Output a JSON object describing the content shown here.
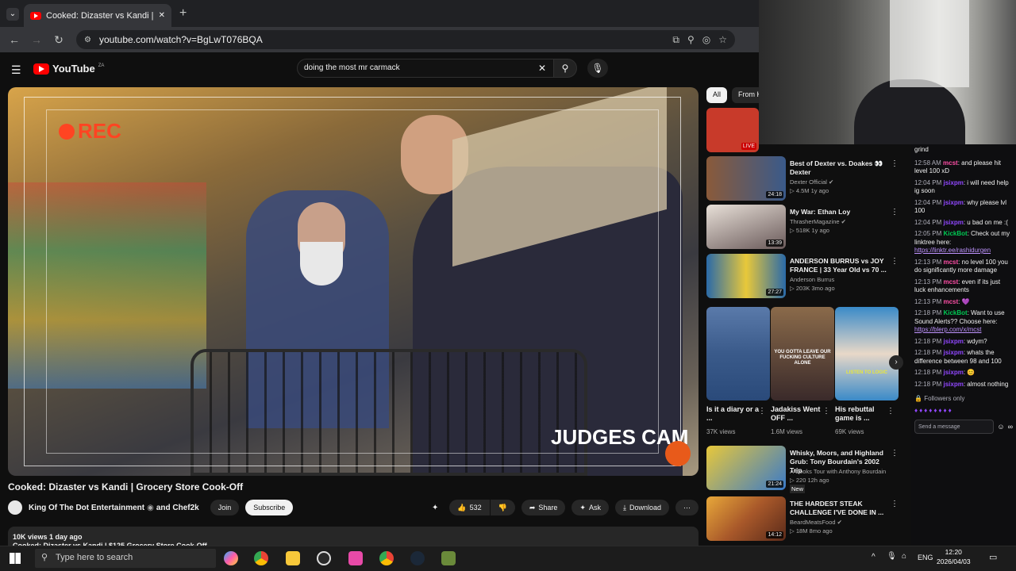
{
  "browser": {
    "tab_title": "Cooked: Dizaster vs Kandi |",
    "new_tab": "+",
    "url": "youtube.com/watch?v=BgLwT076BQA"
  },
  "youtube": {
    "logo_text": "YouTube",
    "logo_country": "ZA",
    "search_value": "doing the most mr carmack",
    "search_clear": "✕"
  },
  "video": {
    "overlay_rec": "REC",
    "overlay_label": "JUDGES CAM",
    "title": "Cooked: Dizaster vs Kandi | Grocery Store Cook-Off",
    "channel": "King Of The Dot Entertainment",
    "collab": "and Chef2k",
    "join_label": "Join",
    "subscribe_label": "Subscribe",
    "likes": "532",
    "share_label": "Share",
    "ask_label": "Ask",
    "download_label": "Download",
    "stats": "10K views  1 day ago",
    "desc_preview": "Cooked: Dizaster vs Kandi | $125 Grocery Store Cook-Off"
  },
  "sidebar": {
    "chips": [
      "All",
      "From Ki"
    ],
    "items": [
      {
        "title": "",
        "channel": "",
        "meta": "",
        "duration": "LIVE",
        "thumb": "#c83a2a"
      },
      {
        "title": "Best of Dexter vs. Doakes 👀 Dexter",
        "channel": "Dexter Official ✔",
        "meta": "▷ 4.5M  1y ago",
        "duration": "24:18",
        "thumb": "#3a5a8a"
      },
      {
        "title": "My War: Ethan Loy",
        "channel": "ThrasherMagazine ✔",
        "meta": "▷ 518K  1y ago",
        "duration": "13:39",
        "thumb": "#6a5a5a"
      },
      {
        "title": "ANDERSON BURRUS vs JOY FRANCE | 33 Year Old vs 70 ...",
        "channel": "Anderson Burrus",
        "meta": "▷ 203K  3mo ago",
        "duration": "27:27",
        "thumb": "#2a6aa8"
      },
      {
        "title": "Whisky, Moors, and Highland Grub: Tony Bourdain's 2002 Trip",
        "channel": "A Cooks Tour with Anthony Bourdain",
        "meta": "▷ 220  12h ago",
        "badge": "New",
        "duration": "21:24",
        "thumb": "#c8a83a"
      },
      {
        "title": "THE HARDEST STEAK CHALLENGE I'VE DONE IN ...",
        "channel": "BeardMeatsFood ✔",
        "meta": "▷ 18M  8mo ago",
        "duration": "14:12",
        "thumb": "#a8582a"
      }
    ],
    "shorts": [
      {
        "title": "Is it a diary or a ...",
        "views": "37K views",
        "thumb": "#4a6a9a"
      },
      {
        "title": "Jadakiss Went OFF ...",
        "views": "1.6M views",
        "thumb": "#5a4a3a",
        "caption": "YOU GOTTA LEAVE OUR FUCKING CULTURE ALONE"
      },
      {
        "title": "His rebuttal game is ...",
        "views": "69K views",
        "thumb": "#3a8ac8",
        "caption": "LISTEN TO LOGIC"
      }
    ]
  },
  "chat": {
    "messages": [
      {
        "ts": "",
        "user": "",
        "text": "grind"
      },
      {
        "ts": "12:58 AM",
        "user": "mcst",
        "text": ": and please hit level 100 xD"
      },
      {
        "ts": "12:04 PM",
        "user": "jsixpm",
        "text": ": i will need help ig soon"
      },
      {
        "ts": "12:04 PM",
        "user": "jsixpm",
        "text": ": why please lvl 100"
      },
      {
        "ts": "12:04 PM",
        "user": "jsixpm",
        "text": ": u bad on me :("
      },
      {
        "ts": "12:05 PM",
        "user": "KickBot",
        "text": ": Check out my linktree here:",
        "link": "https://linktr.ee/rashidurgen"
      },
      {
        "ts": "12:13 PM",
        "user": "mcst",
        "text": ": no level 100 you do significantly more damage"
      },
      {
        "ts": "12:13 PM",
        "user": "mcst",
        "text": ": even if its just luck enhancements"
      },
      {
        "ts": "12:13 PM",
        "user": "mcst",
        "text": ": 💜"
      },
      {
        "ts": "12:18 PM",
        "user": "KickBot",
        "text": ": Want to use Sound Alerts?? Choose here:",
        "link": "https://blerp.com/x/mcst"
      },
      {
        "ts": "12:18 PM",
        "user": "jsixpm",
        "text": ": wdym?"
      },
      {
        "ts": "12:18 PM",
        "user": "jsixpm",
        "text": ": whats the difference between 98 and 100"
      },
      {
        "ts": "12:18 PM",
        "user": "jsixpm",
        "text": ": 😊"
      },
      {
        "ts": "12:18 PM",
        "user": "jsixpm",
        "text": ": almost nothing"
      }
    ],
    "followers_only": "Followers only",
    "send_placeholder": "Send a message"
  },
  "taskbar": {
    "search_placeholder": "Type here to search",
    "lang": "ENG",
    "time": "12:20",
    "date": "2026/04/03"
  }
}
